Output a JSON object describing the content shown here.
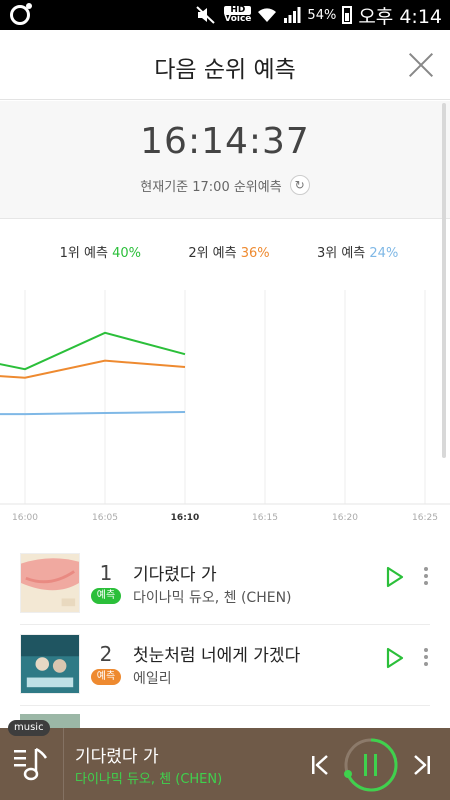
{
  "status_bar": {
    "hd_label": "HD",
    "voice_label": "Voice",
    "battery": "54%",
    "time": "오후 4:14"
  },
  "header": {
    "title": "다음 순위 예측"
  },
  "clock": {
    "time": "16:14:37",
    "basis": "현재기준 17:00 순위예측"
  },
  "legend": [
    {
      "label": "1위 예측",
      "pct": "40%",
      "color": "#2bbf3a"
    },
    {
      "label": "2위 예측",
      "pct": "36%",
      "color": "#ee8a30"
    },
    {
      "label": "3위 예측",
      "pct": "24%",
      "color": "#7fb8e6"
    }
  ],
  "chart_data": {
    "type": "line",
    "x": [
      "16:00",
      "16:05",
      "16:10",
      "16:15",
      "16:20",
      "16:25"
    ],
    "highlight_x": "16:10",
    "ylim": [
      0,
      100
    ],
    "grid": "vertical",
    "series": [
      {
        "color": "#2bbf3a",
        "points": [
          {
            "x": "15:58",
            "y": 66
          },
          {
            "x": "16:00",
            "y": 63
          },
          {
            "x": "16:05",
            "y": 80
          },
          {
            "x": "16:10",
            "y": 70
          }
        ]
      },
      {
        "color": "#ee8a30",
        "points": [
          {
            "x": "15:58",
            "y": 60
          },
          {
            "x": "16:00",
            "y": 59
          },
          {
            "x": "16:05",
            "y": 67
          },
          {
            "x": "16:10",
            "y": 64
          }
        ]
      },
      {
        "color": "#7fb8e6",
        "points": [
          {
            "x": "15:58",
            "y": 42
          },
          {
            "x": "16:00",
            "y": 42
          },
          {
            "x": "16:05",
            "y": 42.5
          },
          {
            "x": "16:10",
            "y": 43
          }
        ]
      }
    ]
  },
  "songs": [
    {
      "rank": "1",
      "badge": "예측",
      "badge_color": "#2bbf3a",
      "title": "기다렸다 가",
      "artist": "다이나믹 듀오, 첸 (CHEN)"
    },
    {
      "rank": "2",
      "badge": "예측",
      "badge_color": "#ee8a30",
      "title": "첫눈처럼 너에게 가겠다",
      "artist": "에일리"
    }
  ],
  "player": {
    "tag": "music",
    "title": "기다렸다 가",
    "artist": "다이나믹 듀오, 첸 (CHEN)"
  },
  "icons": {
    "close": "close-icon",
    "refresh": "refresh-icon",
    "play": "play-icon",
    "more": "more-vertical-icon",
    "prev": "previous-track-icon",
    "pause": "pause-icon",
    "next": "next-track-icon",
    "music_menu": "music-menu-icon"
  }
}
